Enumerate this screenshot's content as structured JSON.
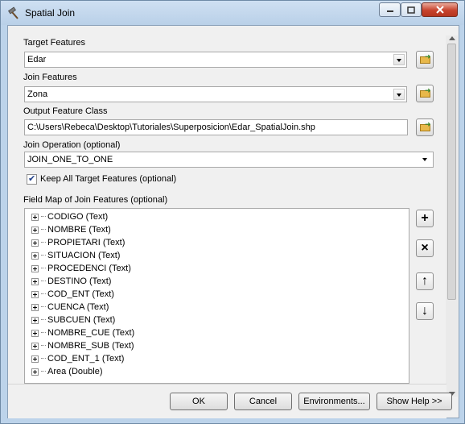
{
  "window": {
    "title": "Spatial Join"
  },
  "form": {
    "target_label": "Target Features",
    "target_value": "Edar",
    "join_label": "Join Features",
    "join_value": "Zona",
    "output_label": "Output Feature Class",
    "output_value": "C:\\Users\\Rebeca\\Desktop\\Tutoriales\\Superposicion\\Edar_SpatialJoin.shp",
    "operation_label": "Join Operation (optional)",
    "operation_value": "JOIN_ONE_TO_ONE",
    "keep_all_label": "Keep All Target Features (optional)",
    "keep_all_checked": true,
    "fieldmap_label": "Field Map of Join Features (optional)"
  },
  "fields": [
    "CODIGO (Text)",
    "NOMBRE (Text)",
    "PROPIETARI (Text)",
    "SITUACION (Text)",
    "PROCEDENCI (Text)",
    "DESTINO (Text)",
    "COD_ENT (Text)",
    "CUENCA (Text)",
    "SUBCUEN (Text)",
    "NOMBRE_CUE (Text)",
    "NOMBRE_SUB (Text)",
    "COD_ENT_1 (Text)",
    "Area (Double)"
  ],
  "side_buttons": {
    "add": "+",
    "remove": "×",
    "up": "↑",
    "down": "↓"
  },
  "buttons": {
    "ok": "OK",
    "cancel": "Cancel",
    "environments": "Environments...",
    "show_help": "Show Help >>"
  },
  "colors": {
    "frame": "#bcd3ea",
    "close": "#c7432e"
  }
}
